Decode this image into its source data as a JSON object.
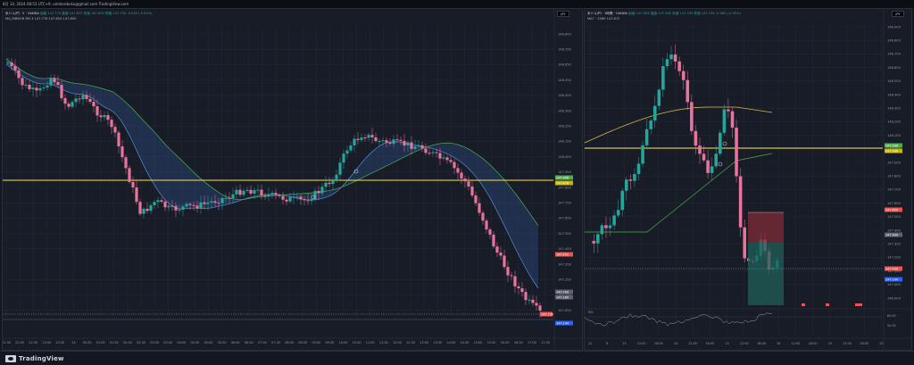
{
  "header": {
    "info": "8月 14, 2024 08:53 UTC+9,  umitaroboku@gmail.com TradingView.com"
  },
  "left_chart": {
    "symbol": "米ドル/円 · 5 · OANDA",
    "ohlc": "始値 147.770  高値 147.875  安値 147.629  終値 147.735  -0.035 (-0.02%)",
    "indicator": "MA_RIBBON MS-3  147.778  147.854  147.890",
    "currency": "JPY",
    "price_labels": [
      "148.850",
      "148.750",
      "148.650",
      "148.550",
      "148.450",
      "148.350",
      "148.250",
      "148.150",
      "148.050",
      "147.950",
      "147.850",
      "147.750",
      "147.650",
      "147.550",
      "147.450",
      "147.350",
      "147.250",
      "147.150",
      "147.050"
    ],
    "time_labels": [
      "21:30",
      "22:00",
      "22:30",
      "23:00",
      "23:30",
      "14",
      "00:30",
      "01:00",
      "01:30",
      "02:00",
      "02:30",
      "03:00",
      "03:30",
      "04:00",
      "04:30",
      "05:00",
      "05:30",
      "06:00",
      "06:30",
      "07:00",
      "07:30",
      "08:00",
      "08:30",
      "09:00",
      "09:30",
      "10:00",
      "10:30",
      "11:00",
      "11:30",
      "12:00",
      "12:30",
      "13:00",
      "13:30",
      "14:00",
      "14:30",
      "15:00",
      "15:30",
      "16:00",
      "16:30",
      "17:00",
      "17:30"
    ],
    "yellow_level": "147.906",
    "yellow_level2": "147.876",
    "last_price": "147.735",
    "red_tag": "147.455",
    "blue_tag": "147.144",
    "gray_tag": "147.200",
    "gray_tag2": "147.180"
  },
  "right_chart": {
    "symbol": "米ドル/円 · 1時間 · OANDA",
    "ohlc": "始値 147.9XX  高値 147.985  安値 147.705  終値 147.735  -0.080 (-0.05%)",
    "indicator": "MA7 · 2569  147.672",
    "currency": "JPY",
    "price_labels": [
      "148.900",
      "148.800",
      "148.700",
      "148.600",
      "148.500",
      "148.400",
      "148.300",
      "148.200",
      "148.100",
      "148.000",
      "147.900",
      "147.800",
      "147.700",
      "147.600",
      "147.500",
      "147.400",
      "147.300",
      "147.200",
      "147.100",
      "147.000",
      "146.900"
    ],
    "time_labels": [
      "12",
      "8",
      "13",
      "12:00",
      "18:00",
      "14",
      "12:00",
      "18:00",
      "15",
      "12:00",
      "18:00",
      "16",
      "12:00",
      "18:00",
      "19",
      "12:00",
      "18:00",
      "20"
    ],
    "yellow_level": "147.906",
    "red_tag": "147.455",
    "blue_tag": "147.144",
    "sub_label": "RSI",
    "sub_values": [
      "80.00",
      "50.00"
    ]
  },
  "footer": {
    "brand": "TradingView"
  },
  "colors": {
    "up": "#26a69a",
    "down": "#ef5350",
    "level": "#f5e94a",
    "bg": "#181c27"
  }
}
